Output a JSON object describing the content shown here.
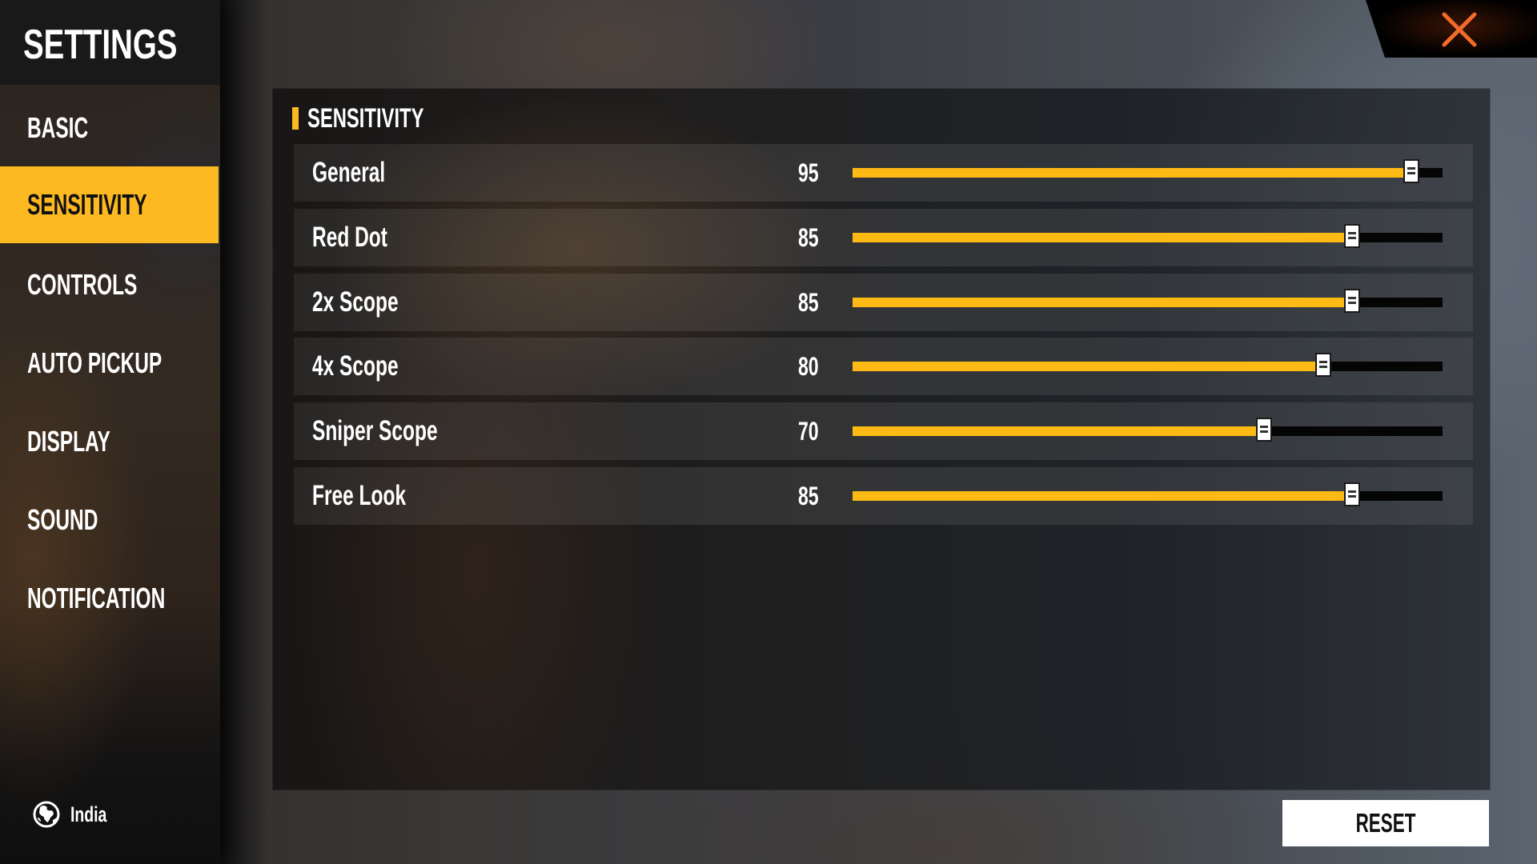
{
  "sidebar": {
    "title": "SETTINGS",
    "items": [
      {
        "label": "BASIC",
        "active": false
      },
      {
        "label": "SENSITIVITY",
        "active": true
      },
      {
        "label": "CONTROLS",
        "active": false
      },
      {
        "label": "AUTO PICKUP",
        "active": false
      },
      {
        "label": "DISPLAY",
        "active": false
      },
      {
        "label": "SOUND",
        "active": false
      },
      {
        "label": "NOTIFICATION",
        "active": false
      }
    ],
    "region": {
      "icon": "globe-icon",
      "label": "India"
    }
  },
  "close_button": {
    "icon": "close-icon",
    "color": "#f26b2a"
  },
  "panel": {
    "section_title": "SENSITIVITY",
    "slider_min": 0,
    "slider_max": 100,
    "settings": [
      {
        "label": "General",
        "value": 95
      },
      {
        "label": "Red Dot",
        "value": 85
      },
      {
        "label": "2x Scope",
        "value": 85
      },
      {
        "label": "4x Scope",
        "value": 80
      },
      {
        "label": "Sniper Scope",
        "value": 70
      },
      {
        "label": "Free Look",
        "value": 85
      }
    ]
  },
  "reset_button": {
    "label": "RESET"
  },
  "colors": {
    "accent": "#fdb921",
    "track_fill": "#fdb914",
    "track_empty": "#050505",
    "close": "#f26b2a"
  }
}
